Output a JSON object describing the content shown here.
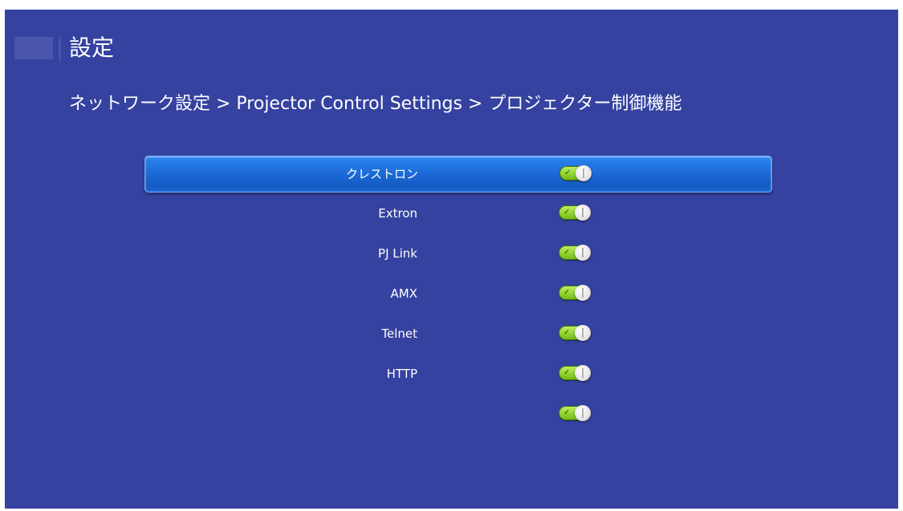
{
  "header": {
    "title": "設定",
    "breadcrumb": "ネットワーク設定 > Projector Control Settings > プロジェクター制御機能"
  },
  "menu": {
    "items": [
      {
        "label": "クレストロン",
        "enabled": true,
        "selected": true
      },
      {
        "label": "Extron",
        "enabled": true,
        "selected": false
      },
      {
        "label": "PJ Link",
        "enabled": true,
        "selected": false
      },
      {
        "label": "AMX",
        "enabled": true,
        "selected": false
      },
      {
        "label": "Telnet",
        "enabled": true,
        "selected": false
      },
      {
        "label": "HTTP",
        "enabled": true,
        "selected": false
      },
      {
        "label": "",
        "enabled": true,
        "selected": false
      }
    ]
  },
  "colors": {
    "background": "#3542a0",
    "selection": "#1f6fdc",
    "toggle_on": "#8fd12a",
    "text": "#ffffff"
  },
  "icons": {
    "toggle": "toggle-switch-icon",
    "check": "check-icon"
  }
}
